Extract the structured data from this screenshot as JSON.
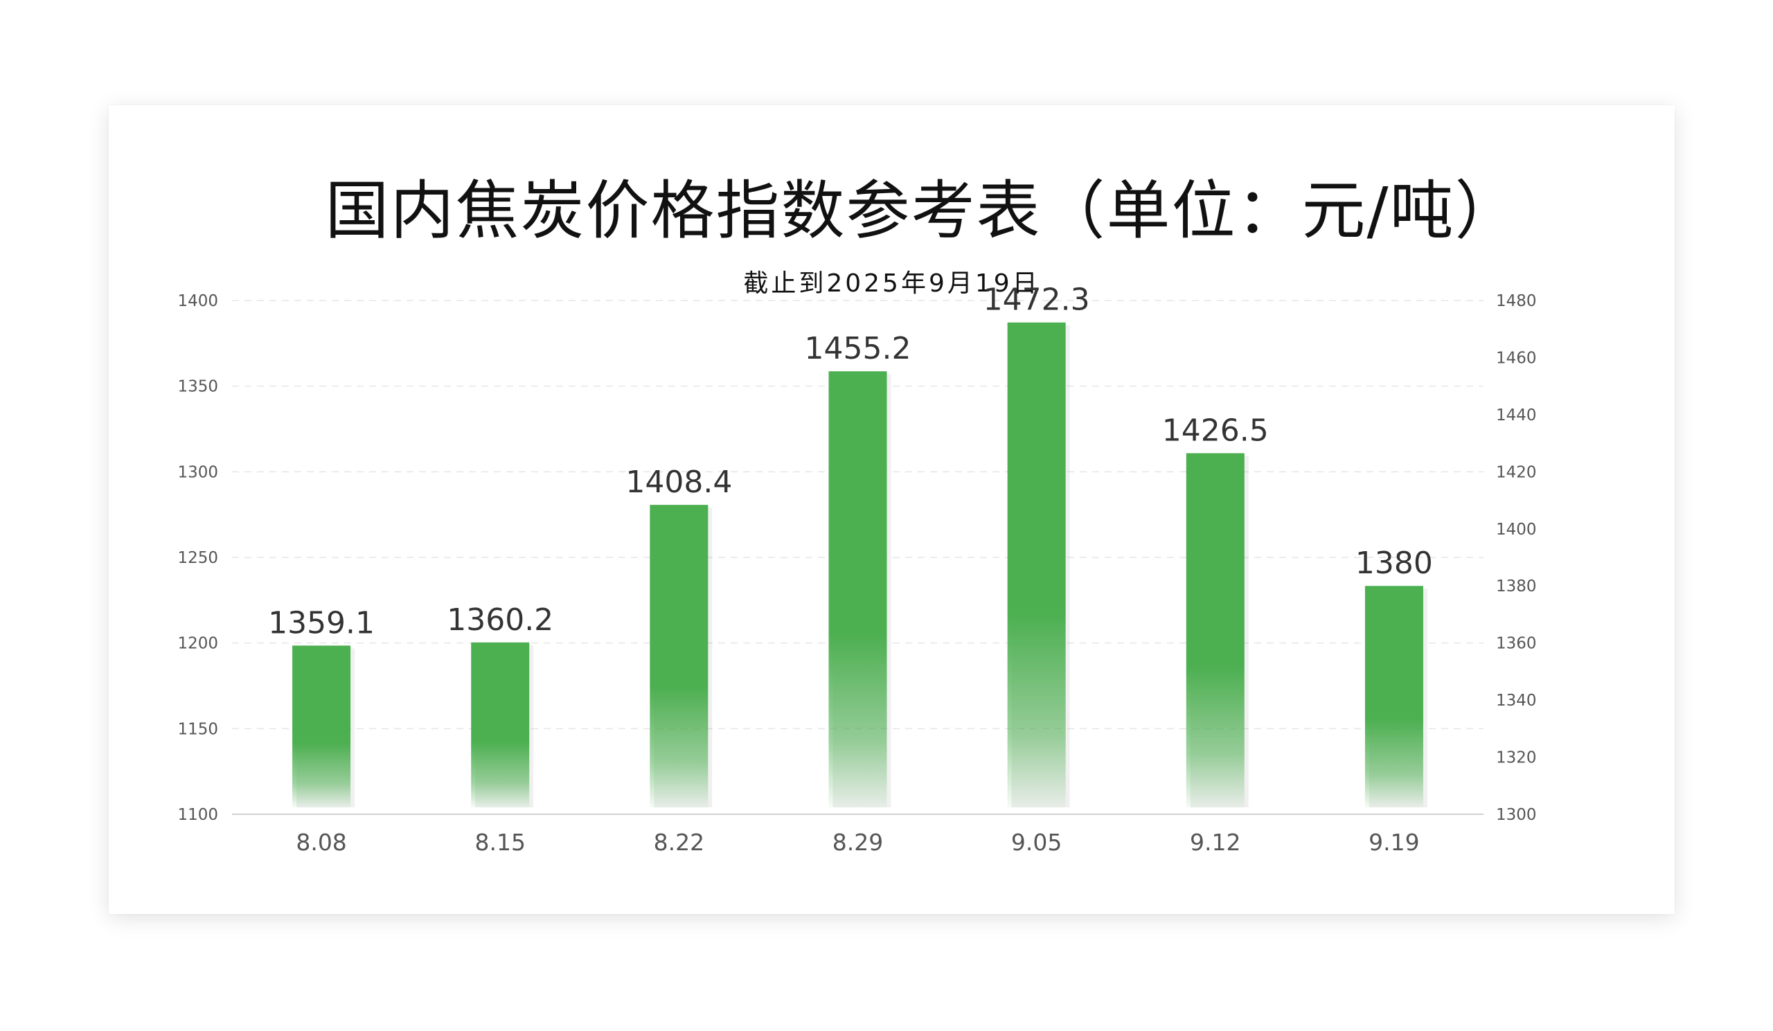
{
  "chart_data": {
    "type": "bar",
    "title": "国内焦炭价格指数参考表（单位：元/吨）",
    "subtitle": "截止到2025年9月19日",
    "categories": [
      "8.08",
      "8.15",
      "8.22",
      "8.29",
      "9.05",
      "9.12",
      "9.19"
    ],
    "series": [
      {
        "values": [
          1359.1,
          1360.2,
          1408.4,
          1455.2,
          1472.3,
          1426.5,
          1380
        ]
      }
    ],
    "y_left": {
      "ticks": [
        1100,
        1150,
        1200,
        1250,
        1300,
        1350,
        1400
      ],
      "ylim": [
        1100,
        1400
      ]
    },
    "y_right": {
      "ticks": [
        1300,
        1320,
        1340,
        1360,
        1380,
        1400,
        1420,
        1440,
        1460,
        1480
      ],
      "ylim": [
        1300,
        1480
      ]
    },
    "bar_axis": "right",
    "grid": true,
    "legend": "none",
    "colors": {
      "bar": "#4caf50",
      "grid": "#e6e6e6",
      "axis": "#d0d0d0"
    }
  }
}
